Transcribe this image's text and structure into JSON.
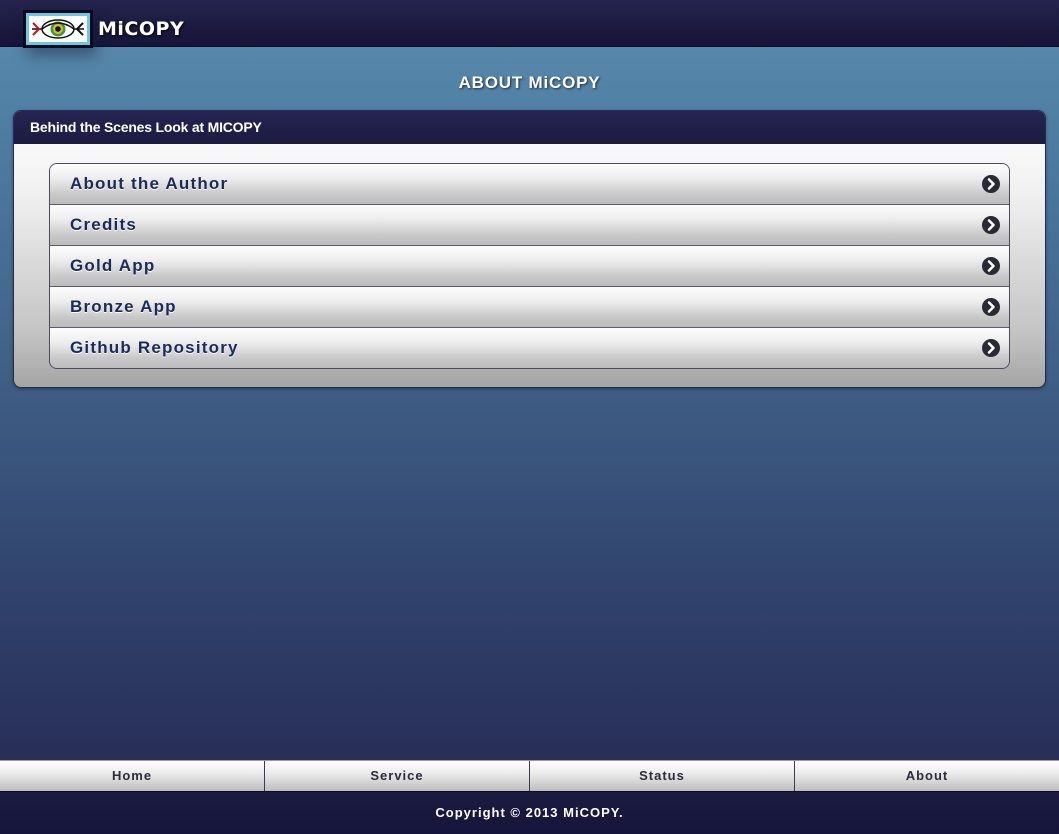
{
  "header": {
    "brand": "MiCOPY",
    "logo_icon": "eye-logo-icon"
  },
  "page": {
    "title": "ABOUT MiCOPY"
  },
  "panel": {
    "title": "Behind the Scenes Look at MICOPY",
    "items": [
      {
        "label": "About the Author",
        "icon": "chevron-right-circle-icon"
      },
      {
        "label": "Credits",
        "icon": "chevron-right-circle-icon"
      },
      {
        "label": "Gold App",
        "icon": "chevron-right-circle-icon"
      },
      {
        "label": "Bronze App",
        "icon": "chevron-right-circle-icon"
      },
      {
        "label": "Github Repository",
        "icon": "chevron-right-circle-icon"
      }
    ]
  },
  "bottom_nav": {
    "tabs": [
      {
        "label": "Home"
      },
      {
        "label": "Service"
      },
      {
        "label": "Status"
      },
      {
        "label": "About"
      }
    ]
  },
  "footer": {
    "copyright": "Copyright © 2013 MiCOPY."
  },
  "colors": {
    "header_bg": "#1b1a3e",
    "item_text": "#1b2a5c",
    "logo_bg": "#6fc6e4"
  }
}
